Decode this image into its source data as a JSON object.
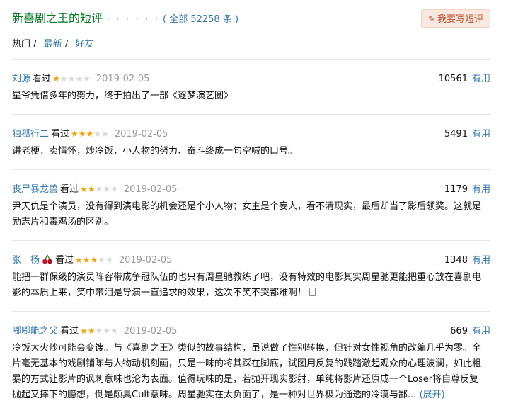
{
  "header": {
    "title": "新喜剧之王的短评",
    "dots": "· · · · · ·",
    "total": "( 全部 52258 条 )",
    "write_button": "我要写短评",
    "write_icon": "pencil-icon"
  },
  "tabs": [
    {
      "label": "热门",
      "sep": "/"
    },
    {
      "label": "最新",
      "sep": "/"
    },
    {
      "label": "好友",
      "sep": ""
    }
  ],
  "colors": {
    "accent_green": "#007722",
    "link_blue": "#3377aa",
    "star_orange": "#f4a300"
  },
  "comments": [
    {
      "user": "刘源",
      "seen": "看过",
      "rating": 1,
      "date": "2019-02-05",
      "votes": "10561",
      "useful": "有用",
      "text": "星爷凭借多年的努力，终于拍出了一部《逐梦演艺圈》"
    },
    {
      "user": "独孤行二",
      "seen": "看过",
      "rating": 3,
      "date": "2019-02-05",
      "votes": "5491",
      "useful": "有用",
      "text": "讲老梗，卖情怀，炒冷饭，小人物的努力、奋斗终成一句空喊的口号。"
    },
    {
      "user": "丧尸暴龙兽",
      "seen": "看过",
      "rating": 2,
      "date": "2019-02-05",
      "votes": "1179",
      "useful": "有用",
      "text": "尹天仇是个演员，没有得到演电影的机会还是个小人物；女主是个妄人，看不清现实，最后却当了影后领奖。这就是励志片和毒鸡汤的区别。"
    },
    {
      "user": "张　杨",
      "seen": "看过",
      "rating": 3,
      "date": "2019-02-05",
      "votes": "1348",
      "useful": "有用",
      "text": "能把一群保级的演员阵容带成争冠队伍的也只有周星驰教练了吧，没有特效的电影其实周星驰更能把重心放在喜剧电影的本质上来，笑中带泪是导演一直追求的效果，这次不笑不哭都难啊！"
    },
    {
      "user": "嘟嘟能之父",
      "seen": "看过",
      "rating": 2,
      "date": "2019-02-05",
      "votes": "669",
      "useful": "有用",
      "text": "冷饭大火炒可能会变馊。与《喜剧之王》类似的故事结构，虽说做了性别转换，但针对女性视角的改编几乎为零。全片毫无基本的戏剧铺陈与人物动机刻画，只是一味的将其踩在脚底，试图用反复的践踏激起观众的心理波澜，如此粗暴的方式让影片的讽刺意味也沦为表面。值得玩味的是，若抛开现实影射，单纯将影片还原成一个Loser将自尊反复抛起又摔下的臆想，倒是颇具Cult意味。周星驰实在太负面了，是一种对世界极为通透的冷漠与鄙...",
      "expand": "(展开)"
    }
  ]
}
